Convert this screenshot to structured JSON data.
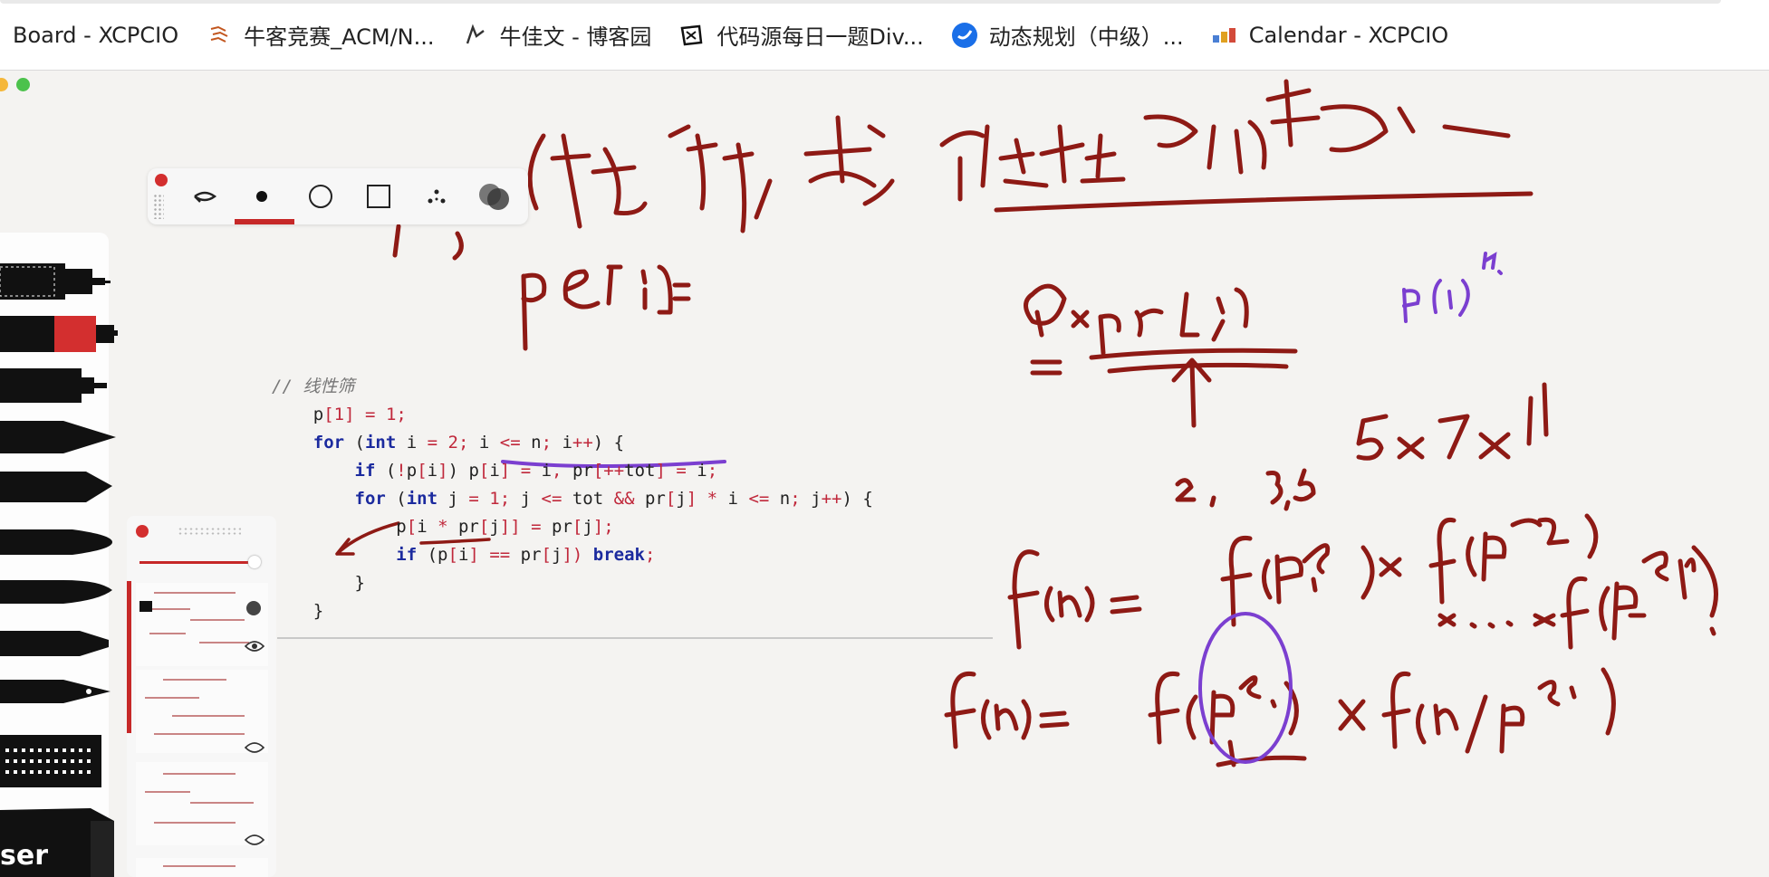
{
  "bookmarks": [
    {
      "label": "Board - XCPCIO",
      "icon": "none"
    },
    {
      "label": "牛客竞赛_ACM/N...",
      "icon": "nowcoder-icon"
    },
    {
      "label": "牛佳文 - 博客园",
      "icon": "cnblogs-icon"
    },
    {
      "label": "代码源每日一题Div...",
      "icon": "daimayuan-icon"
    },
    {
      "label": "动态规划（中级）...",
      "icon": "blue-circle-icon"
    },
    {
      "label": "Calendar - XCPCIO",
      "icon": "xcpcio-icon"
    }
  ],
  "colors": {
    "ink": "#8e1a15",
    "accent_red": "#c62828",
    "purple": "#7b3fd0",
    "code_keyword": "#1b2a9e",
    "code_operator": "#c0283b"
  },
  "toolbar": {
    "tools": [
      "lasso-icon",
      "dot-pen-icon",
      "circle-shape-icon",
      "square-shape-icon",
      "scatter-icon",
      "color-blend-icon"
    ],
    "selected": "dot-pen-icon"
  },
  "pens": [
    "checker-marker-icon",
    "red-marker-icon",
    "fineliner-icon",
    "brush-pen-icon",
    "chisel-marker-icon",
    "round-brush-icon",
    "calligraphy-brush-icon",
    "crayon-icon",
    "fountain-pen-icon",
    "dotted-pen-icon",
    "eraser-icon"
  ],
  "eraser_label": "ser",
  "code": {
    "comment": "// 线性筛",
    "lines": [
      "p[1] = 1;",
      "for (int i = 2; i <= n; i++) {",
      "if (!p[i]) p[i] = i, pr[++tot] = i;",
      "for (int j = 1; j <= tot && pr[j] * i <= n; j++) {",
      "p[i * pr[j]] = pr[j];",
      "if (p[i] == pr[j]) break;",
      "}",
      "}"
    ]
  }
}
